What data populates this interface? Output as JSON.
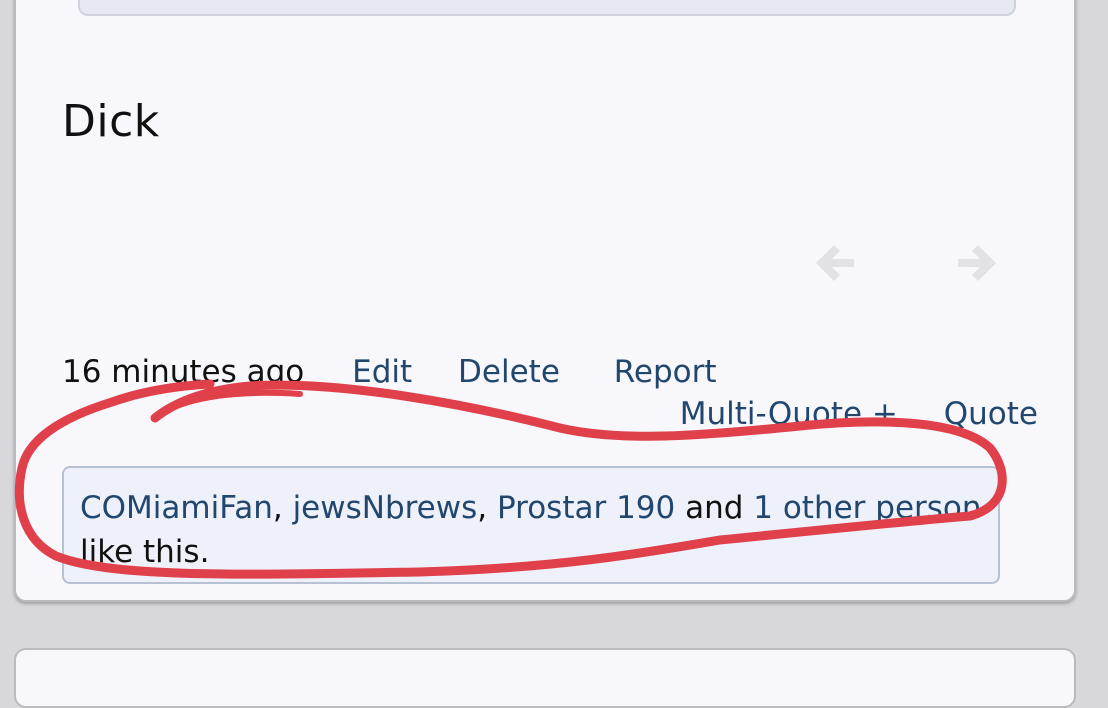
{
  "post": {
    "text": "Dick",
    "timestamp": "16 minutes ago",
    "actions": {
      "edit": "Edit",
      "delete": "Delete",
      "report": "Report",
      "multi_quote": "Multi-Quote +",
      "quote": "Quote"
    },
    "likes": {
      "users": [
        "COMiamiFan",
        "jewsNbrews",
        "Prostar 190"
      ],
      "separator": ", ",
      "conjunction": " and ",
      "others_link": "1 other person",
      "suffix": "like this."
    }
  },
  "icons": {
    "prev": "arrow-left-icon",
    "next": "arrow-right-icon"
  },
  "colors": {
    "link": "#22476e",
    "annotation": "#e0404a",
    "likes_background": "#eef1fa",
    "card_background": "#f7f7fc"
  }
}
